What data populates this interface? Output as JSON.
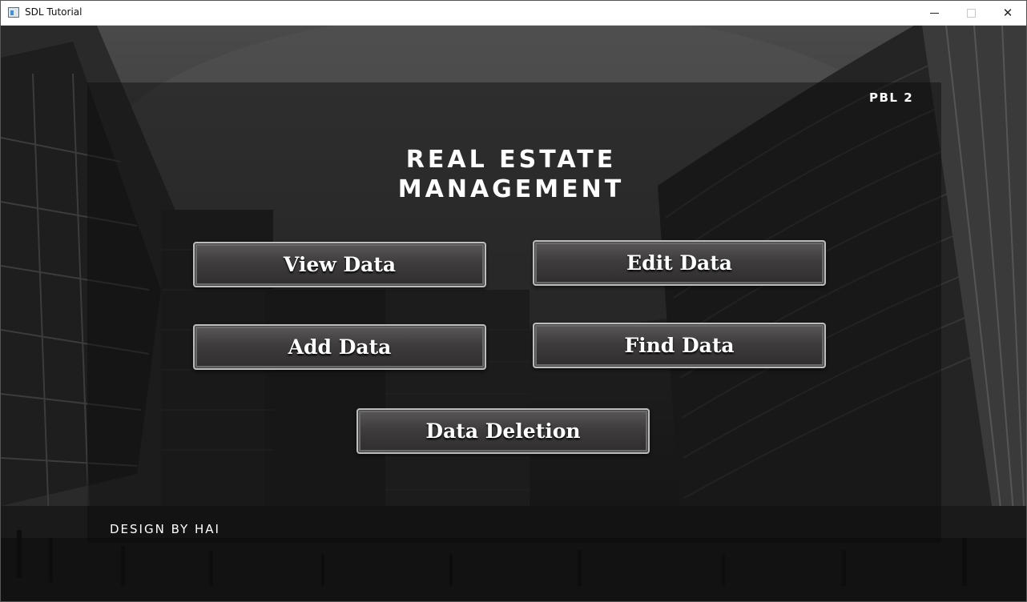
{
  "window": {
    "title": "SDL Tutorial"
  },
  "header": {
    "tag": "PBL 2"
  },
  "main": {
    "title_line1": "REAL ESTATE",
    "title_line2": "MANAGEMENT",
    "buttons": [
      {
        "label": "View Data"
      },
      {
        "label": "Edit Data"
      },
      {
        "label": "Add Data"
      },
      {
        "label": "Find Data"
      },
      {
        "label": "Data Deletion"
      }
    ]
  },
  "footer": {
    "credit": "DESIGN BY HAI"
  },
  "colors": {
    "titlebar": "#ffffff",
    "overlay": "#0a0a0a",
    "button_border": "#bdbdbd",
    "text": "#ffffff"
  },
  "icons": [
    "app-icon",
    "minimize-icon",
    "maximize-icon",
    "close-icon"
  ]
}
